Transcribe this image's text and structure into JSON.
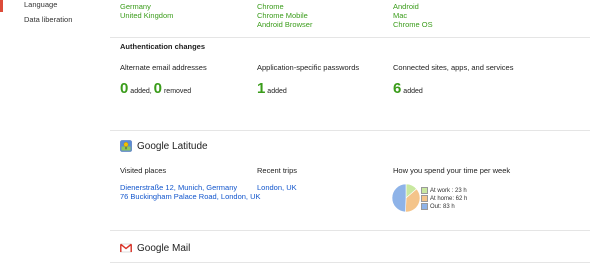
{
  "sidebar": {
    "items": [
      {
        "label": "Language"
      },
      {
        "label": "Data liberation"
      }
    ],
    "accent_color": "#dd4b39"
  },
  "top_lists": {
    "countries": [
      "Germany",
      "United Kingdom"
    ],
    "browsers": [
      "Chrome",
      "Chrome Mobile",
      "Android Browser"
    ],
    "platforms": [
      "Android",
      "Mac",
      "Chrome OS"
    ]
  },
  "auth": {
    "heading": "Authentication changes",
    "email_label": "Alternate email addresses",
    "email_added": "0",
    "email_added_label": "added,",
    "email_removed": "0",
    "email_removed_label": "removed",
    "passwords_label": "Application-specific passwords",
    "passwords_added": "1",
    "passwords_added_label": "added",
    "sites_label": "Connected sites, apps, and services",
    "sites_added": "6",
    "sites_added_label": "added"
  },
  "latitude": {
    "title": "Google Latitude",
    "icon": "latitude-pin-icon",
    "visited_label": "Visited places",
    "visited": [
      "Dienerstraße 12, Munich, Germany",
      "76 Buckingham Palace Road, London, UK"
    ],
    "trips_label": "Recent trips",
    "trips": [
      "London, UK"
    ],
    "time_label": "How you spend your time per week",
    "time_legend": [
      {
        "label": "At work : 23 h",
        "color": "#c9e8a0",
        "hours": 23
      },
      {
        "label": "At home: 62 h",
        "color": "#f4c48a",
        "hours": 62
      },
      {
        "label": "Out: 83 h",
        "color": "#8eb3e8",
        "hours": 83
      }
    ]
  },
  "gmail": {
    "title": "Google Mail",
    "icon": "gmail-envelope-icon"
  },
  "colors": {
    "stat_green": "#3a9c1a",
    "link_blue": "#1155cc"
  }
}
